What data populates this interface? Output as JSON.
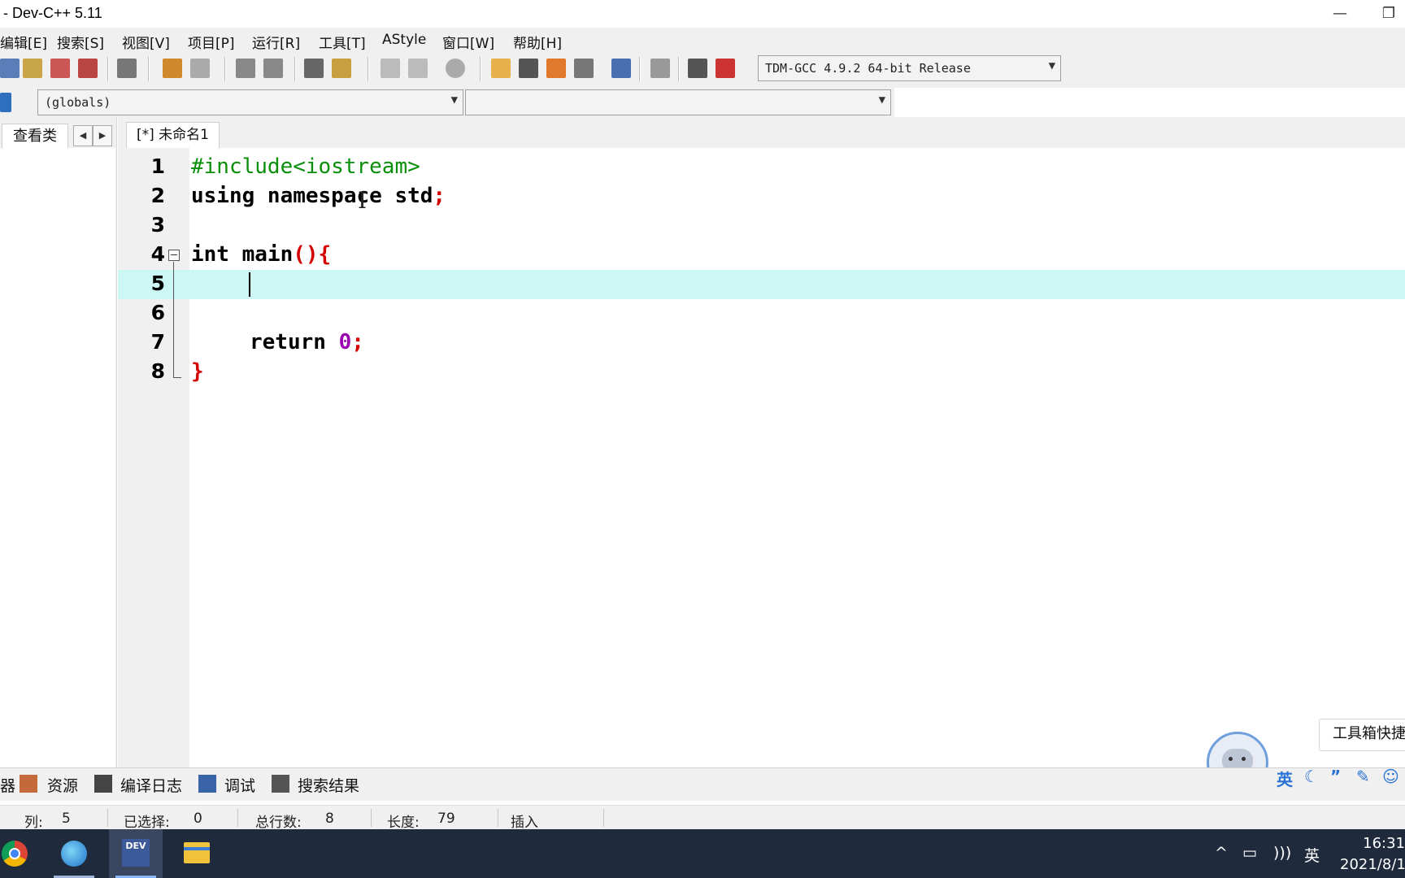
{
  "window": {
    "title": "- Dev-C++ 5.11",
    "minimize_icon": "minimize-icon",
    "restore_icon": "restore-icon"
  },
  "menu": [
    {
      "label": "编辑[E]"
    },
    {
      "label": "搜索[S]"
    },
    {
      "label": "视图[V]"
    },
    {
      "label": "项目[P]"
    },
    {
      "label": "运行[R]"
    },
    {
      "label": "工具[T]"
    },
    {
      "label": "AStyle"
    },
    {
      "label": "窗口[W]"
    },
    {
      "label": "帮助[H]"
    }
  ],
  "toolbar": {
    "compiler": "TDM-GCC 4.9.2 64-bit Release"
  },
  "toolbar2": {
    "scope": "(globals)",
    "function": ""
  },
  "left_panel": {
    "tab_label": "查看类",
    "prev_arrow": "◀",
    "next_arrow": "▶"
  },
  "editor": {
    "tab_label": "[*] 未命名1",
    "lines": [
      {
        "num": "1",
        "pp": "#include<iostream>"
      },
      {
        "num": "2",
        "kw": "using namespace std",
        "semi": ";"
      },
      {
        "num": "3"
      },
      {
        "num": "4",
        "kw": "int main",
        "paren": "(){"
      },
      {
        "num": "5"
      },
      {
        "num": "6"
      },
      {
        "num": "7",
        "kw": "return ",
        "val": "0",
        "semi": ";"
      },
      {
        "num": "8",
        "brace": "}"
      }
    ],
    "active_line": 5
  },
  "bottom_tabs": [
    {
      "label": "器"
    },
    {
      "label": "资源"
    },
    {
      "label": "编译日志"
    },
    {
      "label": "调试"
    },
    {
      "label": "搜索结果"
    }
  ],
  "status": {
    "col_label": "列:",
    "col_value": "5",
    "sel_label": "已选择:",
    "sel_value": "0",
    "lines_label": "总行数:",
    "lines_value": "8",
    "len_label": "长度:",
    "len_value": "79",
    "mode": "插入"
  },
  "ime": {
    "popup_text": "工具箱快捷",
    "lang": "英"
  },
  "taskbar": {
    "apps": [
      "chrome-icon",
      "edge-icon",
      "devcpp-icon",
      "file-explorer-icon"
    ],
    "devcpp_label": "DEV",
    "tray_lang": "英",
    "time": "16:31",
    "date": "2021/8/1"
  }
}
